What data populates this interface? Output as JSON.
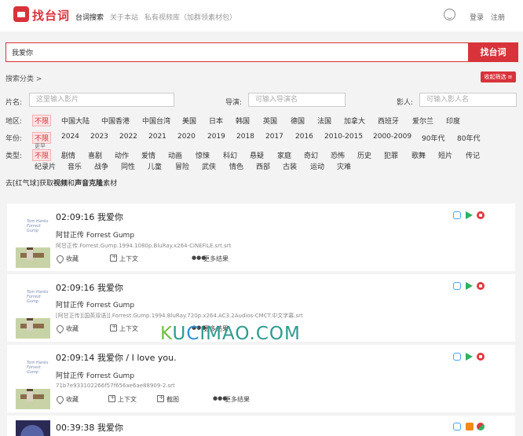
{
  "header": {
    "logo_text": "找台词",
    "nav": [
      "台词搜索",
      "关于本站",
      "私有视频库（加群领素材包）"
    ],
    "login": "登录",
    "register": "注册"
  },
  "search": {
    "value": "我爱你",
    "button": "找台词"
  },
  "filters": {
    "category_label": "搜索分类 >",
    "collapse_label": "收起筛选 ≡",
    "film_label": "片名:",
    "film_placeholder": "这里输入影片",
    "director_label": "导演:",
    "director_placeholder": "可输入导演名",
    "actor_label": "影人:",
    "actor_placeholder": "可输入影人名",
    "region_label": "地区:",
    "regions": [
      "不限",
      "中国大陆",
      "中国香港",
      "中国台湾",
      "美国",
      "日本",
      "韩国",
      "英国",
      "德国",
      "法国",
      "加拿大",
      "西班牙",
      "爱尔兰",
      "印度"
    ],
    "year_label": "年份:",
    "years": [
      "不限",
      "2024",
      "2023",
      "2022",
      "2021",
      "2020",
      "2019",
      "2018",
      "2017",
      "2016",
      "2010-2015",
      "2000-2009",
      "90年代",
      "80年代"
    ],
    "year_extra": "更早",
    "type_label": "类型:",
    "types_row1": [
      "不限",
      "剧情",
      "喜剧",
      "动作",
      "爱情",
      "动画",
      "惊悚",
      "科幻",
      "悬疑",
      "家庭",
      "奇幻",
      "恐怖",
      "历史",
      "犯罪",
      "歌舞",
      "短片",
      "传记"
    ],
    "types_row2": [
      "纪录片",
      "音乐",
      "战争",
      "同性",
      "儿童",
      "冒险",
      "武侠",
      "情色",
      "西部",
      "古装",
      "运动",
      "灾难"
    ]
  },
  "promo": {
    "prefix": "去[红气球]获取",
    "b1": "视频",
    "mid": "和",
    "b2": "声音克隆",
    "suffix": "素材"
  },
  "results": [
    {
      "time": "02:09:16 我爱你",
      "title": "阿甘正传 Forrest Gump",
      "file": "阿甘正传.Forrest.Gump.1994.1080p.BluRay.x264-CiNEFiLE.srt.srt",
      "poster_text": "Tom Hanks Forrest Gump",
      "actions": [
        "收藏",
        "上下文",
        "更多结果"
      ]
    },
    {
      "time": "02:09:16 我爱你",
      "title": "阿甘正传 Forrest Gump",
      "file": "[阿甘正传][国英双语]].Forrest.Gump.1994.BluRay.720p.x264.AC3.2Audios-CMCT.中文字幕.srt",
      "poster_text": "Tom Hanks Forrest Gump",
      "actions": [
        "收藏",
        "上下文",
        "更多结果"
      ]
    },
    {
      "time": "02:09:14 我爱你 / I love you.",
      "title": "阿甘正传 Forrest Gump",
      "file": "71b7e933102266f57f656ae6ae88909-2.srt",
      "poster_text": "Tom Hanks Forrest Gump",
      "actions": [
        "收藏",
        "上下文",
        "截图",
        "更多结果"
      ]
    },
    {
      "time": "00:39:38 我爱你"
    }
  ],
  "watermark": {
    "k": "K",
    "u": "U",
    "c": "C",
    "rest": "IMAO.COM"
  },
  "colors": {
    "brand": "#d8333b",
    "tv_icon": "#46a6ff",
    "play_icon": "#2fb15f"
  }
}
